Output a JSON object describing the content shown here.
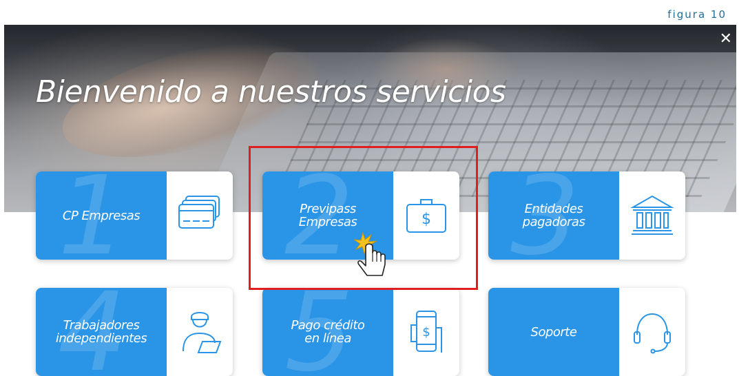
{
  "caption": "figura 10",
  "hero": {
    "title": "Bienvenido a nuestros servicios"
  },
  "close_label": "✕",
  "cards": [
    {
      "number": "1",
      "label_line1": "CP Empresas",
      "label_line2": "",
      "icon": "credit-card-icon"
    },
    {
      "number": "2",
      "label_line1": "Previpass",
      "label_line2": "Empresas",
      "icon": "briefcase-dollar-icon"
    },
    {
      "number": "3",
      "label_line1": "Entidades",
      "label_line2": "pagadoras",
      "icon": "bank-icon"
    },
    {
      "number": "4",
      "label_line1": "Trabajadores",
      "label_line2": "independientes",
      "icon": "worker-laptop-icon"
    },
    {
      "number": "5",
      "label_line1": "Pago crédito",
      "label_line2": "en línea",
      "icon": "mobile-payment-icon"
    },
    {
      "number": "",
      "label_line1": "Soporte",
      "label_line2": "",
      "icon": "headset-icon"
    }
  ],
  "colors": {
    "card_blue": "#2a94e6",
    "highlight": "#e01e22",
    "caption": "#1f6f9a"
  }
}
